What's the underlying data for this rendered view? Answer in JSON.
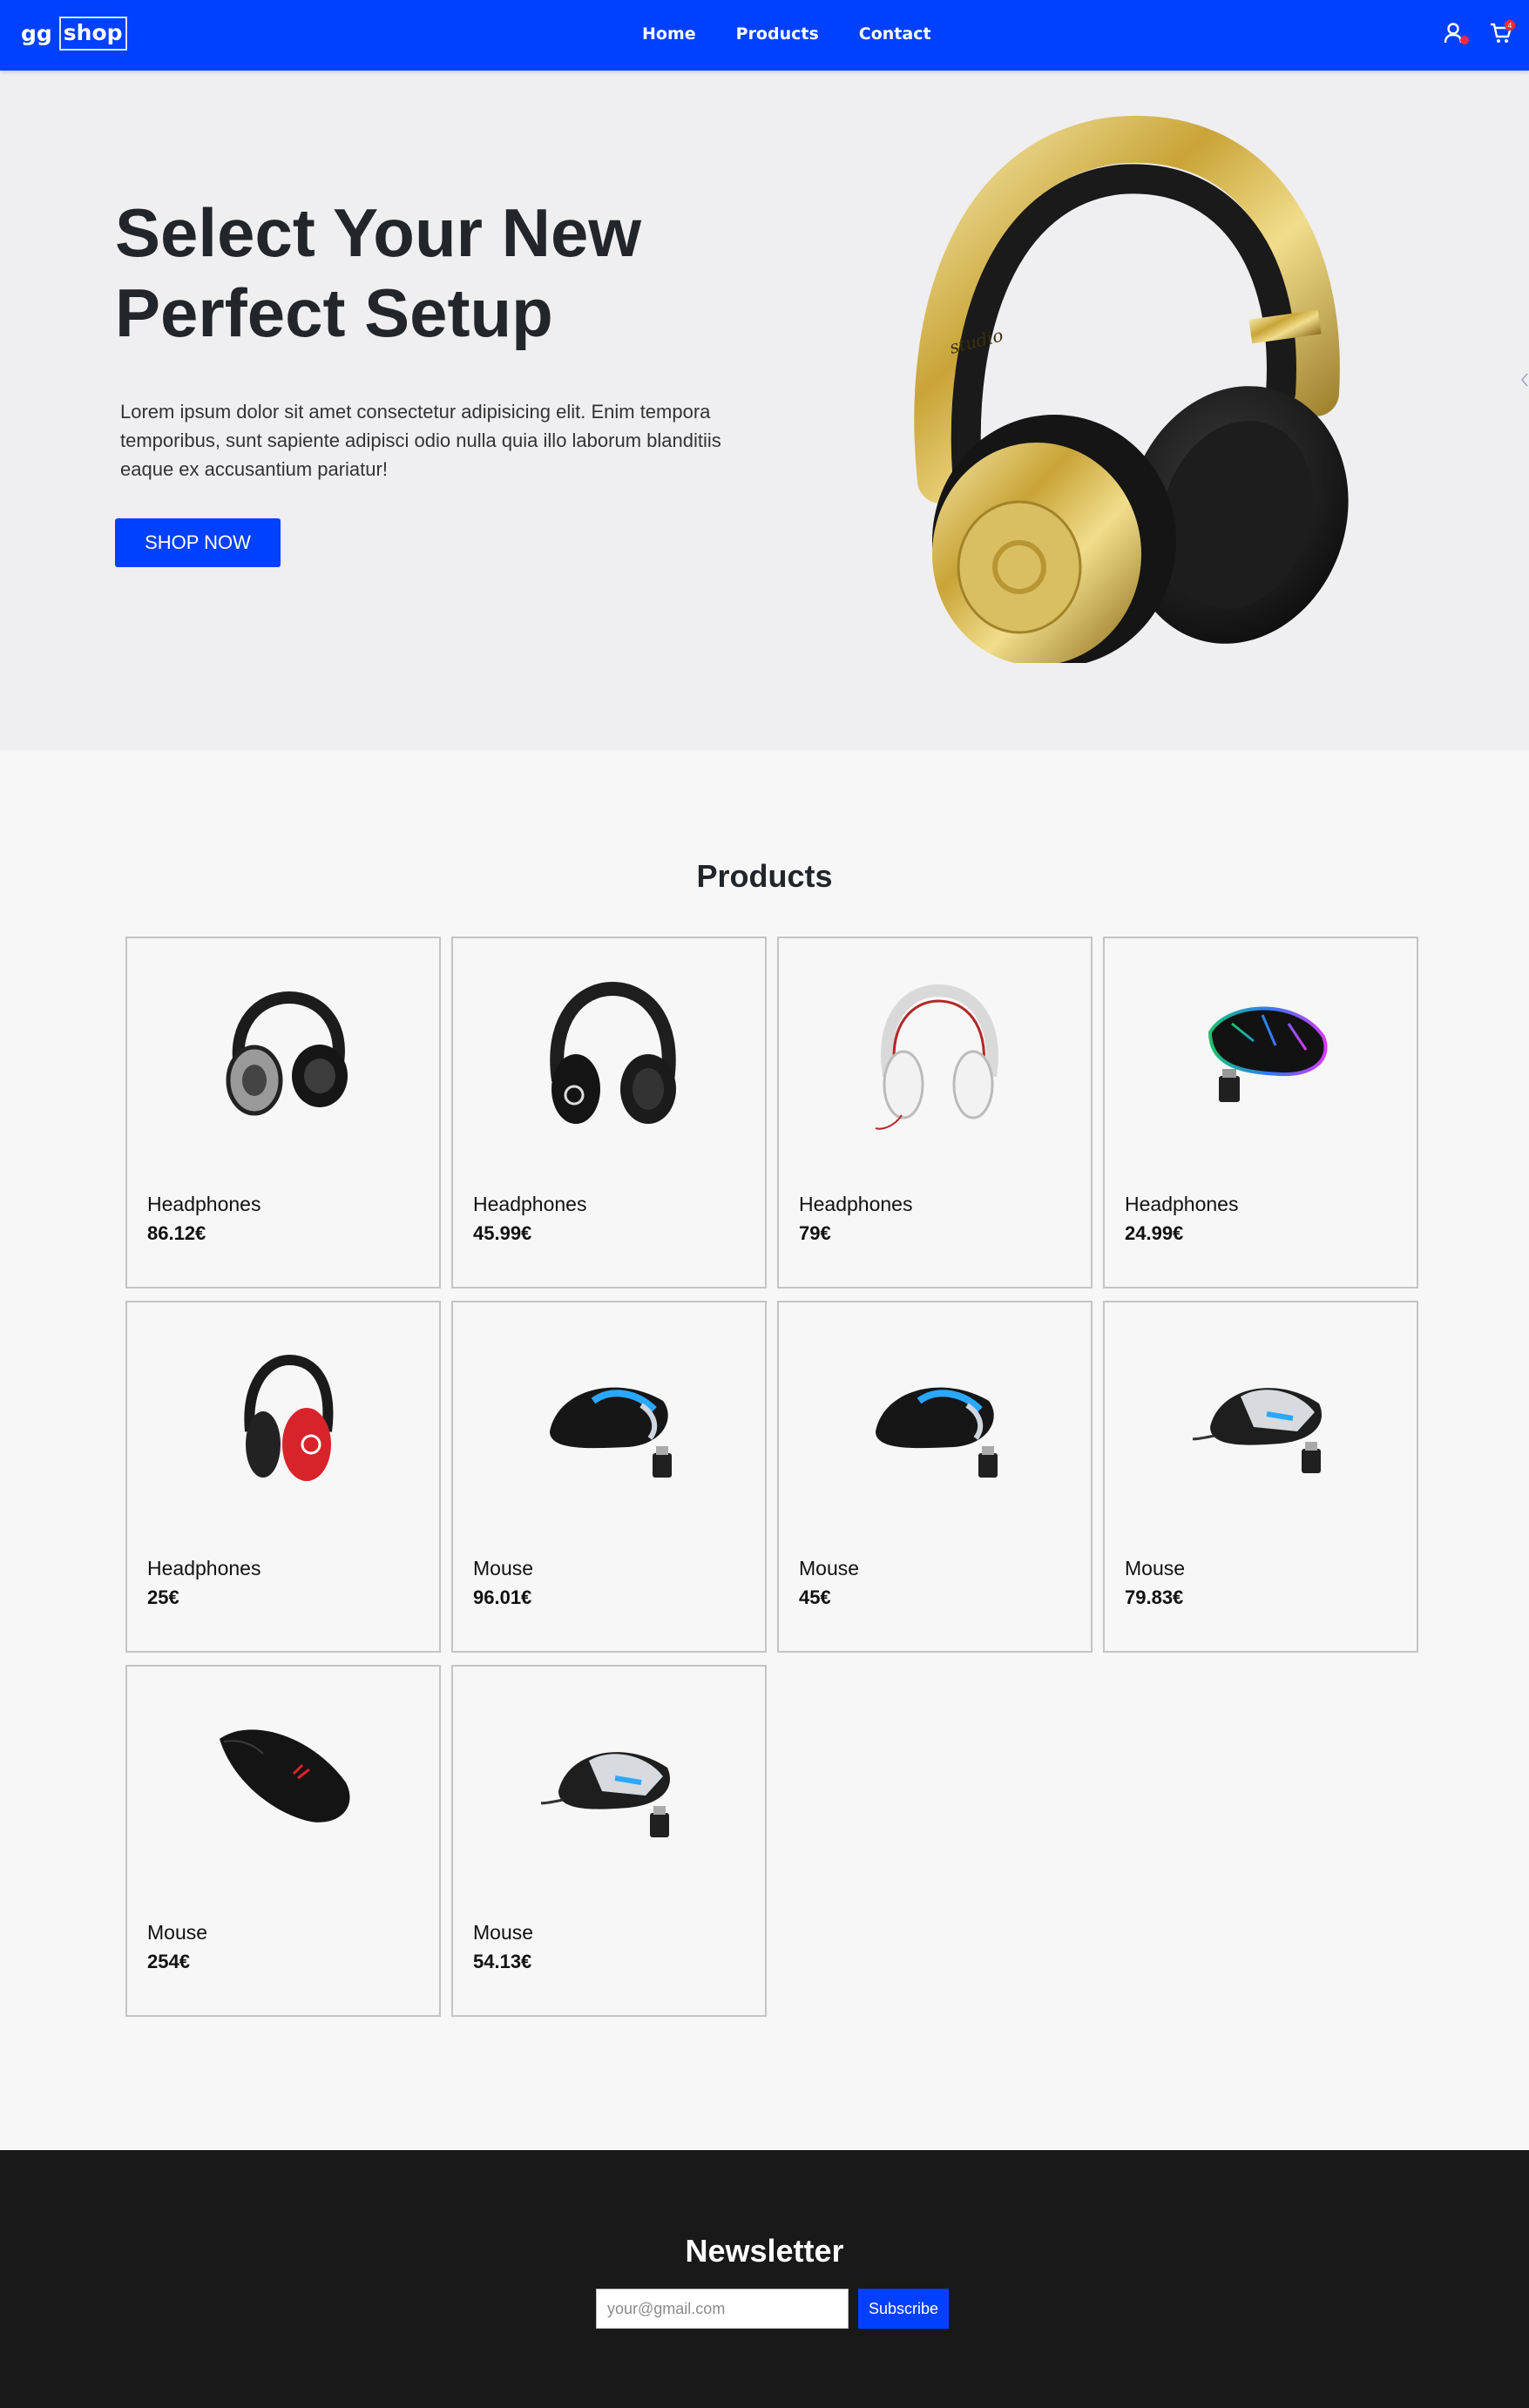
{
  "colors": {
    "brand": "#0040ff",
    "hero_bg": "#efeff1",
    "page_bg": "#f7f7f7",
    "footer_bg": "#191919",
    "badge": "#ff2a3a"
  },
  "navbar": {
    "logo_left": "gg",
    "logo_right": "shop",
    "links": [
      "Home",
      "Products",
      "Contact"
    ],
    "icons": [
      "user-icon",
      "cart-icon"
    ],
    "cart_badge": "4"
  },
  "hero": {
    "title": "Select Your New Perfect Setup",
    "text": "Lorem ipsum dolor sit amet consectetur adipisicing elit. Enim tempora temporibus, sunt sapiente adipisci odio nulla quia illo laborum blanditiis eaque ex accusantium pariatur!",
    "button": "SHOP NOW",
    "image": "gold-headphones-image"
  },
  "products": {
    "title": "Products",
    "items": [
      {
        "name": "Headphones",
        "price": "86.12€",
        "image": "dj-headphones-image"
      },
      {
        "name": "Headphones",
        "price": "45.99€",
        "image": "black-headphones-image"
      },
      {
        "name": "Headphones",
        "price": "79€",
        "image": "white-headphones-image"
      },
      {
        "name": "Headphones",
        "price": "24.99€",
        "image": "rgb-mouse-image"
      },
      {
        "name": "Headphones",
        "price": "25€",
        "image": "red-headphones-image"
      },
      {
        "name": "Mouse",
        "price": "96.01€",
        "image": "wireless-mouse-image"
      },
      {
        "name": "Mouse",
        "price": "45€",
        "image": "wireless-mouse-image"
      },
      {
        "name": "Mouse",
        "price": "79.83€",
        "image": "silver-mouse-image"
      },
      {
        "name": "Mouse",
        "price": "254€",
        "image": "black-gaming-mouse-image"
      },
      {
        "name": "Mouse",
        "price": "54.13€",
        "image": "silver-mouse-image"
      }
    ]
  },
  "newsletter": {
    "title": "Newsletter",
    "placeholder": "your@gmail.com",
    "button": "Subscribe"
  }
}
